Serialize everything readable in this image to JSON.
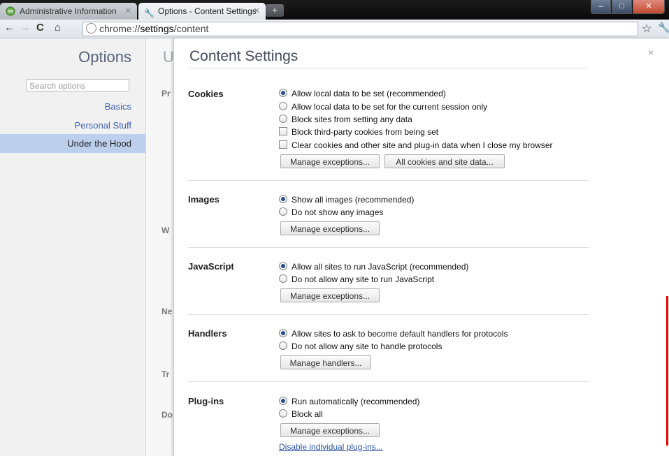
{
  "tabs": [
    {
      "title": "Administrative Information",
      "active": false
    },
    {
      "title": "Options - Content Settings",
      "active": true
    }
  ],
  "address": {
    "prefix": "chrome://",
    "host": "settings",
    "path": "/content"
  },
  "sidebar": {
    "title": "Options",
    "search_placeholder": "Search options",
    "items": [
      {
        "label": "Basics"
      },
      {
        "label": "Personal Stuff"
      },
      {
        "label": "Under the Hood",
        "selected": true
      }
    ]
  },
  "background_page": {
    "heading": "U",
    "sections": [
      "Pr",
      "W",
      "Ne",
      "Tr",
      "Do"
    ]
  },
  "dialog": {
    "title": "Content Settings",
    "close": "×",
    "sections": {
      "cookies": {
        "label": "Cookies",
        "options": [
          "Allow local data to be set (recommended)",
          "Allow local data to be set for the current session only",
          "Block sites from setting any data",
          "Block third-party cookies from being set",
          "Clear cookies and other site and plug-in data when I close my browser"
        ],
        "buttons": [
          "Manage exceptions...",
          "All cookies and site data..."
        ]
      },
      "images": {
        "label": "Images",
        "options": [
          "Show all images (recommended)",
          "Do not show any images"
        ],
        "button": "Manage exceptions..."
      },
      "javascript": {
        "label": "JavaScript",
        "options": [
          "Allow all sites to run JavaScript (recommended)",
          "Do not allow any site to run JavaScript"
        ],
        "button": "Manage exceptions..."
      },
      "handlers": {
        "label": "Handlers",
        "options": [
          "Allow sites to ask to become default handlers for protocols",
          "Do not allow any site to handle protocols"
        ],
        "button": "Manage handlers..."
      },
      "plugins": {
        "label": "Plug-ins",
        "options": [
          "Run automatically (recommended)",
          "Block all"
        ],
        "button": "Manage exceptions...",
        "link": "Disable individual plug-ins..."
      }
    }
  }
}
